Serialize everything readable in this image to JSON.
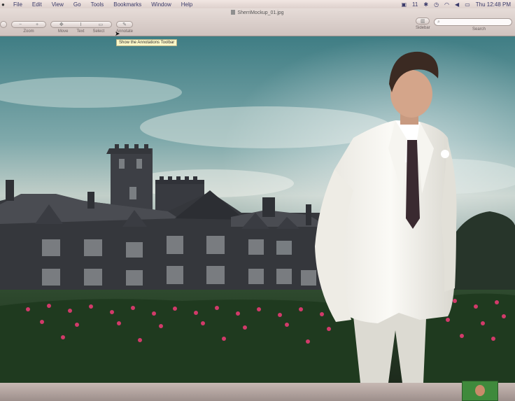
{
  "menubar": {
    "items": [
      "File",
      "Edit",
      "View",
      "Go",
      "Tools",
      "Bookmarks",
      "Window",
      "Help"
    ],
    "status_number": "11",
    "clock": "Thu 12:48 PM"
  },
  "window": {
    "title": "SherriMockup_01.jpg"
  },
  "toolbar": {
    "zoom_label": "Zoom",
    "move_label": "Move",
    "text_label": "Text",
    "select_label": "Select",
    "annotate_label": "Annotate",
    "sidebar_label": "Sidebar",
    "search_label": "Search",
    "search_placeholder": ""
  },
  "tooltip": {
    "text": "Show the Annotations Toolbar"
  },
  "colors": {
    "sky": "#4f8b90",
    "castle_stone": "#3a3c40",
    "roses": "#d23a6a",
    "suit": "#f2f0ea"
  }
}
